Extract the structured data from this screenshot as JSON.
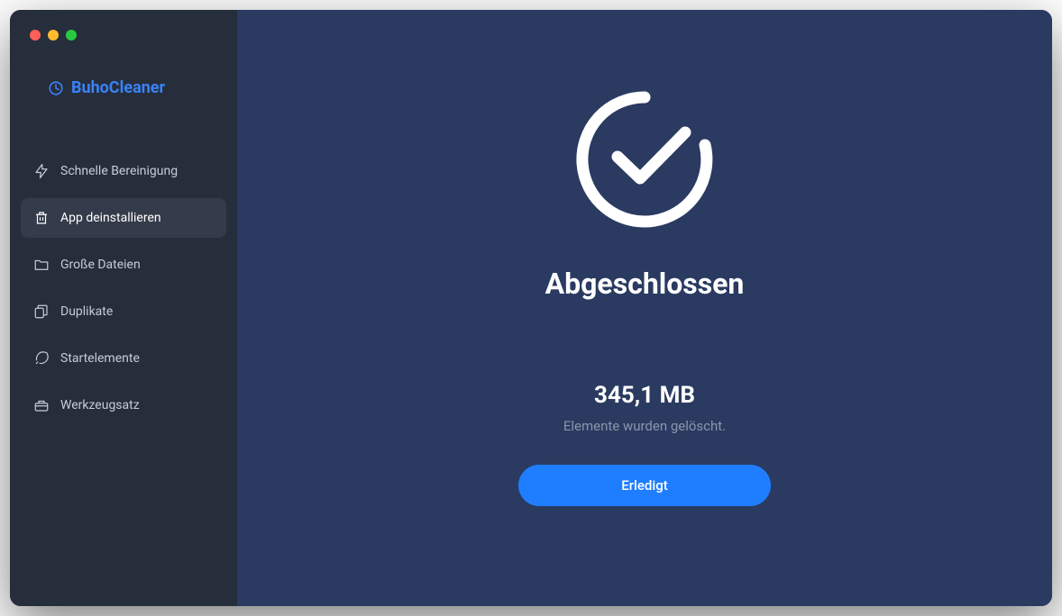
{
  "app": {
    "name": "BuhoCleaner"
  },
  "sidebar": {
    "items": [
      {
        "label": "Schnelle Bereinigung",
        "icon": "lightning"
      },
      {
        "label": "App deinstallieren",
        "icon": "trash",
        "active": true
      },
      {
        "label": "Große Dateien",
        "icon": "folder"
      },
      {
        "label": "Duplikate",
        "icon": "copy"
      },
      {
        "label": "Startelemente",
        "icon": "rocket"
      },
      {
        "label": "Werkzeugsatz",
        "icon": "toolbox"
      }
    ]
  },
  "main": {
    "completed_title": "Abgeschlossen",
    "size_cleaned": "345,1 MB",
    "deleted_message": "Elemente wurden gelöscht.",
    "done_button": "Erledigt"
  }
}
